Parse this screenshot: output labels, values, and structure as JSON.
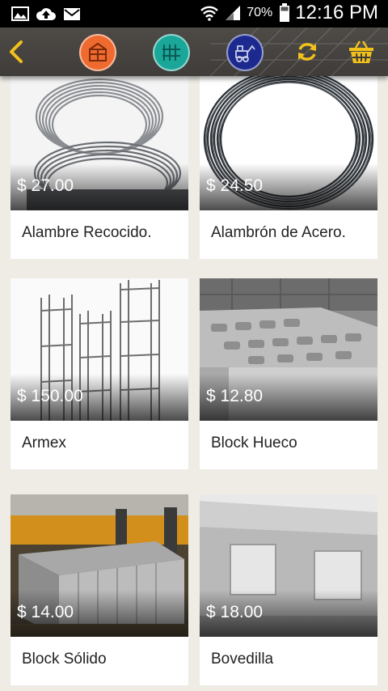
{
  "status_bar": {
    "battery": "70%",
    "time": "12:16 PM",
    "left_icons": [
      "image-icon",
      "upload-cloud-icon",
      "mail-icon"
    ],
    "right_icons": [
      "wifi-icon",
      "signal-icon",
      "battery-icon"
    ]
  },
  "app_bar": {
    "colors": {
      "category_1": "#ef6a2e",
      "category_2": "#1aa79a",
      "category_3": "#1c2a8f",
      "accent": "#f2c21b"
    },
    "icons": [
      "back-arrow-icon",
      "construction-category-icon",
      "grid-category-icon",
      "machinery-category-icon",
      "refresh-icon",
      "shopping-basket-icon"
    ]
  },
  "products": [
    {
      "price": "$ 27.00",
      "name": "Alambre Recocido.",
      "image": "wire-coil"
    },
    {
      "price": "$ 24.50",
      "name": "Alambrón de Acero.",
      "image": "wire-rod"
    },
    {
      "price": "$ 150.00",
      "name": "Armex",
      "image": "rebar-cages"
    },
    {
      "price": "$ 12.80",
      "name": "Block Hueco",
      "image": "hollow-block"
    },
    {
      "price": "$ 14.00",
      "name": "Block Sólido",
      "image": "solid-block"
    },
    {
      "price": "$ 18.00",
      "name": "Bovedilla",
      "image": "bovedilla"
    }
  ]
}
